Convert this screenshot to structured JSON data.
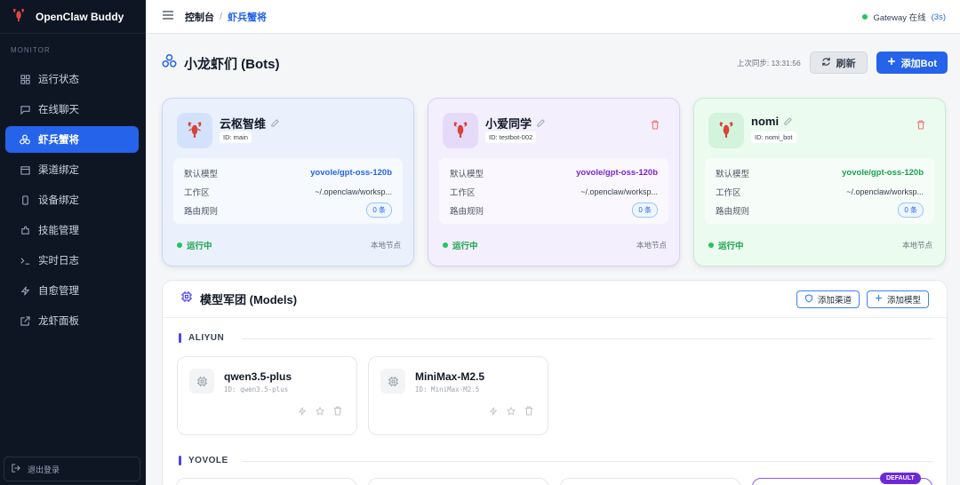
{
  "app": {
    "name": "OpenClaw Buddy"
  },
  "sidebar": {
    "section_label": "MONITOR",
    "items": [
      {
        "label": "运行状态",
        "icon": "grid-icon"
      },
      {
        "label": "在线聊天",
        "icon": "chat-icon"
      },
      {
        "label": "虾兵蟹将",
        "icon": "bots-icon",
        "active": true
      },
      {
        "label": "渠道绑定",
        "icon": "calendar-icon"
      },
      {
        "label": "设备绑定",
        "icon": "device-icon"
      },
      {
        "label": "技能管理",
        "icon": "puzzle-icon"
      },
      {
        "label": "实时日志",
        "icon": "terminal-icon"
      },
      {
        "label": "自愈管理",
        "icon": "bolt-icon"
      },
      {
        "label": "龙虾面板",
        "icon": "external-link-icon"
      }
    ],
    "logout_label": "退出登录"
  },
  "topbar": {
    "breadcrumb_root": "控制台",
    "breadcrumb_sep": "/",
    "breadcrumb_current": "虾兵蟹将",
    "gateway_label": "Gateway 在线",
    "gateway_timer": "(3s)"
  },
  "header": {
    "title": "小龙虾们 (Bots)",
    "last_sync": "上次同步: 13:31:56",
    "refresh_label": "刷新",
    "add_bot_label": "添加Bot"
  },
  "bot_labels": {
    "model": "默认模型",
    "workspace": "工作区",
    "routing": "路由规则"
  },
  "bots": [
    {
      "name": "云枢智维",
      "id": "ID: main",
      "model": "yovole/gpt-oss-120b",
      "workspace": "~/.openclaw/worksp...",
      "routes": "0 条",
      "status": "运行中",
      "node": "本地节点"
    },
    {
      "name": "小爱同学",
      "id": "ID: testbot-002",
      "model": "yovole/gpt-oss-120b",
      "workspace": "~/.openclaw/worksp...",
      "routes": "0 条",
      "status": "运行中",
      "node": "本地节点"
    },
    {
      "name": "nomi",
      "id": "ID: nomi_bot",
      "model": "yovole/gpt-oss-120b",
      "workspace": "~/.openclaw/worksp...",
      "routes": "0 条",
      "status": "运行中",
      "node": "本地节点"
    }
  ],
  "models_panel": {
    "title": "模型军团 (Models)",
    "add_channel_label": "添加渠道",
    "add_model_label": "添加模型",
    "groups": [
      {
        "name": "ALIYUN",
        "models": [
          {
            "name": "qwen3.5-plus",
            "id": "ID: qwen3.5-plus"
          },
          {
            "name": "MiniMax-M2.5",
            "id": "ID: MiniMax-M2.5"
          }
        ]
      },
      {
        "name": "YOVOLE",
        "default_badge": "DEFAULT"
      }
    ]
  },
  "colors": {
    "sidebar_bg": "#0f1623",
    "accent": "#2563eb",
    "online": "#22c55e"
  }
}
